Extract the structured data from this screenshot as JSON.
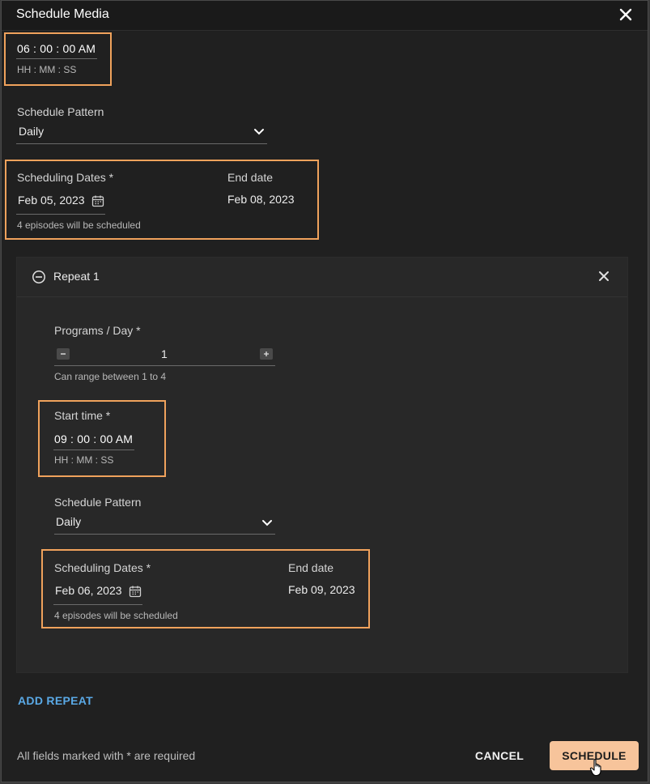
{
  "dialog": {
    "title": "Schedule Media"
  },
  "main": {
    "start_time": {
      "value": "06 : 00 : 00 AM",
      "format": "HH : MM : SS"
    },
    "schedule_pattern": {
      "label": "Schedule Pattern",
      "value": "Daily"
    },
    "scheduling_dates": {
      "label": "Scheduling Dates *",
      "start_date": "Feb 05, 2023",
      "end_label": "End date",
      "end_date": "Feb 08, 2023",
      "note": "4 episodes will be scheduled"
    }
  },
  "repeat": {
    "title": "Repeat 1",
    "programs_per_day": {
      "label": "Programs / Day *",
      "value": "1",
      "hint": "Can range between 1 to 4"
    },
    "start_time": {
      "label": "Start time *",
      "value": "09 : 00 : 00 AM",
      "format": "HH : MM : SS"
    },
    "schedule_pattern": {
      "label": "Schedule Pattern",
      "value": "Daily"
    },
    "scheduling_dates": {
      "label": "Scheduling Dates *",
      "start_date": "Feb 06, 2023",
      "end_label": "End date",
      "end_date": "Feb 09, 2023",
      "note": "4 episodes will be scheduled"
    }
  },
  "actions": {
    "add_repeat": "ADD REPEAT",
    "required_note": "All fields marked with * are required",
    "cancel": "CANCEL",
    "schedule": "SCHEDULE"
  },
  "colors": {
    "highlight": "#f0a25c",
    "link": "#5aa9e6",
    "primary_button": "#f7c49b",
    "background": "#202020"
  },
  "icons": [
    "close-icon",
    "chevron-down-icon",
    "calendar-icon",
    "minus-circle-icon",
    "minus-icon",
    "plus-icon",
    "hand-cursor-icon"
  ]
}
